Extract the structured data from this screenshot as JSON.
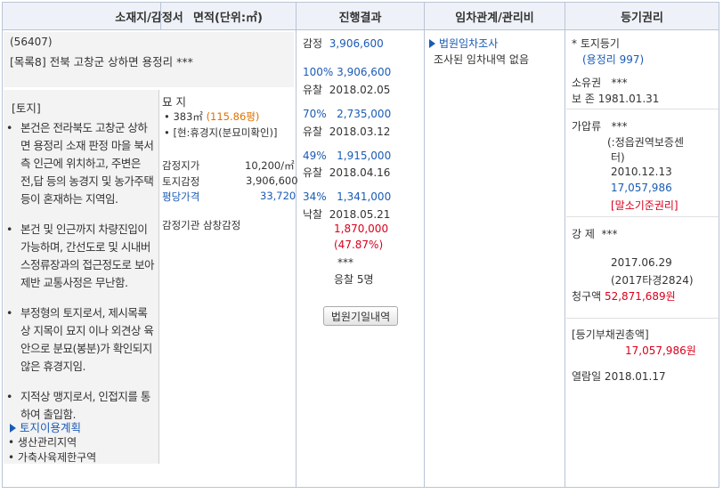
{
  "headers": {
    "location": "소재지/감정서",
    "area": "면적(단위:㎡)",
    "progress": "진행결과",
    "tenancy": "임차관계/관리비",
    "registry": "등기권리"
  },
  "location": {
    "postal": "(56407)",
    "item_tag": "[목록8]",
    "address": "전북 고창군 상하면 용정리 ***",
    "land_tag": "[토지]",
    "notes": [
      "본건은 전라북도 고창군 상하면 용정리 소재 판정 마을 북서측 인근에 위치하고, 주변은 전,답 등의 농경지 및 농가주택 등이 혼재하는 지역임.",
      "본건 및 인근까지 차량진입이 가능하며, 간선도로 및 시내버스정류장과의 접근정도로 보아 제반 교통사정은 무난함.",
      "부정형의 토지로서, 제시목록상 지목이 묘지 이나 외견상 육안으로 분묘(봉분)가 확인되지 않은 휴경지임.",
      "지적상 맹지로서, 인접지를 통하여 출입함."
    ],
    "land_use_title": "토지이용계획",
    "land_use": [
      "생산관리지역",
      "가축사육제한구역"
    ]
  },
  "area": {
    "category": "묘 지",
    "size": "383㎡",
    "pyeong": "(115.86평)",
    "status": "[현:휴경지(분묘미확인)]",
    "unit_price_label": "감정지가",
    "unit_price": "10,200/㎡",
    "appraisal_label": "토지감정",
    "appraisal": "3,906,600",
    "pyeong_price_label": "평당가격",
    "pyeong_price": "33,720",
    "agency": "감정기관  삼창감정"
  },
  "progress": {
    "appraisal_label": "감정",
    "appraisal": "3,906,600",
    "rounds": [
      {
        "pct": "100%",
        "price": "3,906,600",
        "status": "유찰",
        "date": "2018.02.05"
      },
      {
        "pct": "70%",
        "price": "2,735,000",
        "status": "유찰",
        "date": "2018.03.12"
      },
      {
        "pct": "49%",
        "price": "1,915,000",
        "status": "유찰",
        "date": "2018.04.16"
      },
      {
        "pct": "34%",
        "price": "1,341,000",
        "status": "낙찰",
        "date": "2018.05.21"
      }
    ],
    "winning_price": "1,870,000",
    "winning_pct": "(47.87%)",
    "winner": "***",
    "bidders": "응찰 5명",
    "court_button": "법원기일내역"
  },
  "tenancy": {
    "court_link": "법원임차조사",
    "result": "조사된 임차내역 없음"
  },
  "registry": {
    "land_title": "* 토지등기",
    "land_sub": "(용정리 997)",
    "owner_label": "소유권",
    "owner": "***",
    "preserve_label": "보    존",
    "preserve_date": "1981.01.31",
    "seizure_label": "가압류",
    "seizure_who": "***",
    "seizure_note_1": "(:정읍권역보증센",
    "seizure_note_2": "터)",
    "seizure_date": "2010.12.13",
    "seizure_amount": "17,057,986",
    "seizure_tag": "[말소기준권리]",
    "forced_label": "강    제",
    "forced_who": "***",
    "forced_date": "2017.06.29",
    "forced_case": "(2017타경2824)",
    "claim_label": "청구액",
    "claim_amount": "52,871,689원",
    "debt_title": "[등기부채권총액]",
    "debt_amount": "17,057,986원",
    "viewed": "열람일 2018.01.17"
  }
}
